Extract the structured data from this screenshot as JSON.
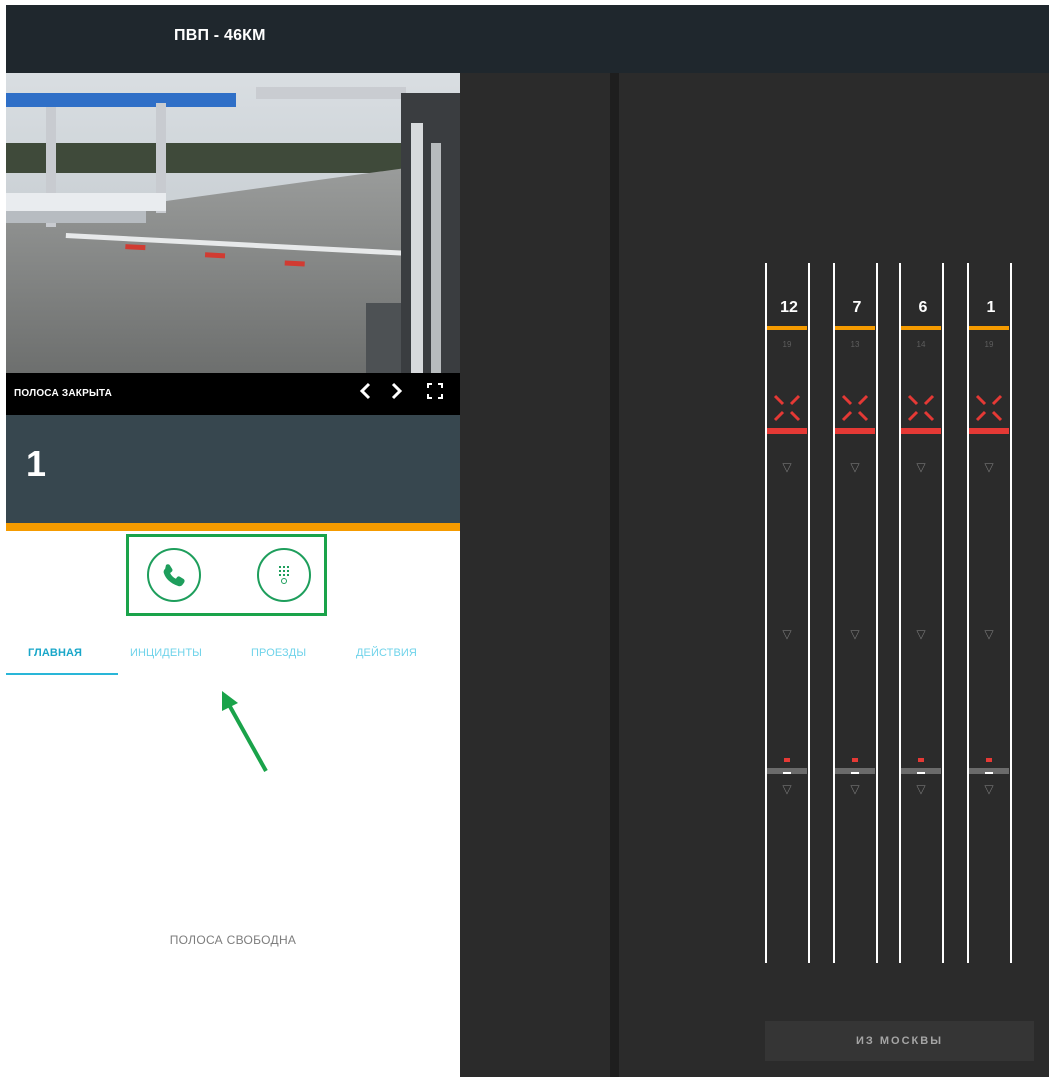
{
  "header": {
    "title": "ПВП - 46КМ"
  },
  "camera": {
    "status": "ПОЛОСА ЗАКРЫТА",
    "controls": [
      {
        "name": "prev-camera-button",
        "glyph": "‹"
      },
      {
        "name": "next-camera-button",
        "glyph": "›"
      },
      {
        "name": "fullscreen-button",
        "glyph": "⛶"
      }
    ]
  },
  "lane_card": {
    "number": "1"
  },
  "actions": [
    {
      "name": "call-button",
      "icon": "phone-icon"
    },
    {
      "name": "dialpad-button",
      "icon": "dialpad-icon"
    }
  ],
  "tabs": [
    {
      "label": "ГЛАВНАЯ",
      "active": true
    },
    {
      "label": "ИНЦИДЕНТЫ",
      "active": false
    },
    {
      "label": "ПРОЕЗДЫ",
      "active": false
    },
    {
      "label": "ДЕЙСТВИЯ",
      "active": false
    }
  ],
  "main": {
    "status_text": "ПОЛОСА СВОБОДНА"
  },
  "lanes": [
    {
      "number": "12",
      "sub": "19"
    },
    {
      "number": "7",
      "sub": "13"
    },
    {
      "number": "6",
      "sub": "14"
    },
    {
      "number": "1",
      "sub": "19"
    }
  ],
  "direction_button": {
    "label": "ИЗ МОСКВЫ"
  },
  "colors": {
    "header_bg": "#1f272d",
    "lane_card_bg": "#37474f",
    "accent_orange": "#f59b00",
    "highlight_green": "#1aa34a",
    "tab_active": "#1aa7c9",
    "closed_red": "#e53935",
    "panel_dark": "#2b2b2b"
  }
}
